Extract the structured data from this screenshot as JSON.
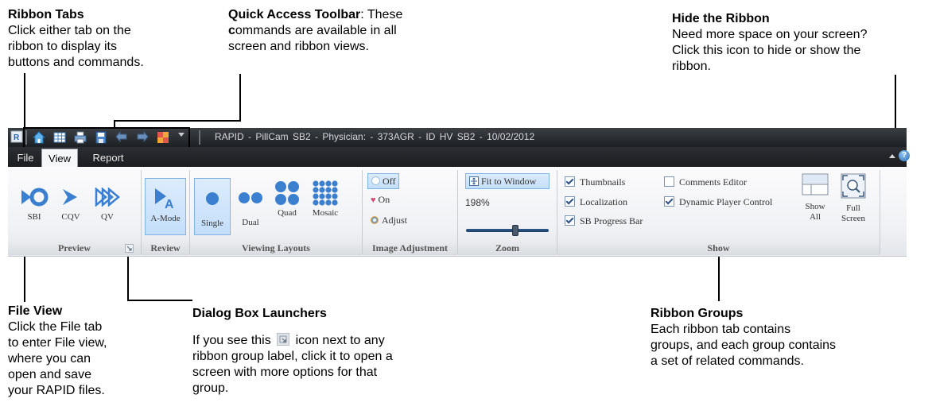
{
  "callouts": {
    "ribbon_tabs": {
      "title": "Ribbon Tabs",
      "lines": [
        "Click either tab on the",
        "ribbon to display its",
        "buttons and commands."
      ]
    },
    "quick_access": {
      "title": "Quick Access Toolbar",
      "title_suffix": ": These",
      "lead_bold": "c",
      "lines_after_lead": "ommands are available in all",
      "lines": [
        "screen and ribbon views."
      ]
    },
    "hide_ribbon": {
      "title": "Hide the Ribbon",
      "lines": [
        "Need more space on your screen?",
        "Click this icon to hide or show the",
        "ribbon."
      ]
    },
    "file_view": {
      "title": "File View",
      "lines": [
        "Click the File tab",
        "to enter File view,",
        "where you can",
        "open and save",
        "your RAPID files."
      ]
    },
    "dialog_launchers": {
      "title": "Dialog Box Launchers",
      "line1_before": "If you see this",
      "line1_after": "icon next to any",
      "lines": [
        "ribbon group label, click it to open a",
        "screen with more options for that",
        "group."
      ]
    },
    "ribbon_groups": {
      "title": "Ribbon Groups",
      "lines": [
        "Each ribbon tab contains",
        "groups, and each group contains",
        "a set of related commands."
      ]
    }
  },
  "window": {
    "title": "RAPID  -  PillCam SB2  -  Physician:  -  373AGR - ID HV SB2  -  10/02/2012",
    "tabs": [
      {
        "label": "File",
        "active": false
      },
      {
        "label": "View",
        "active": true
      },
      {
        "label": "Report",
        "active": false
      }
    ],
    "qat_icons": [
      "home-icon",
      "grid-icon",
      "print-icon",
      "save-icon",
      "back-icon",
      "forward-icon",
      "puzzle-icon"
    ]
  },
  "ribbon": {
    "groups": [
      {
        "label": "Preview"
      },
      {
        "label": "Review"
      },
      {
        "label": "Viewing Layouts"
      },
      {
        "label": "Image Adjustment"
      },
      {
        "label": "Zoom"
      },
      {
        "label": "Show"
      }
    ],
    "preview_buttons": [
      "SBI",
      "CQV",
      "QV"
    ],
    "review_buttons": [
      "A-Mode"
    ],
    "layout_buttons": [
      "Single",
      "Dual",
      "Quad",
      "Mosaic"
    ],
    "adjust_options": [
      "Off",
      "On",
      "Adjust"
    ],
    "zoom": {
      "fit_label": "Fit to Window",
      "level": "198%",
      "slider_fraction": 0.6
    },
    "show_checks": [
      {
        "label": "Thumbnails",
        "checked": true
      },
      {
        "label": "Localization",
        "checked": true
      },
      {
        "label": "SB Progress Bar",
        "checked": true
      },
      {
        "label": "Comments Editor",
        "checked": false
      },
      {
        "label": "Dynamic Player Control",
        "checked": true
      }
    ],
    "show_buttons": [
      {
        "line1": "Show",
        "line2": "All"
      },
      {
        "line1": "Full",
        "line2": "Screen"
      }
    ]
  },
  "colors": {
    "accent_blue": "#3a7fd0",
    "selected_bg": "#c4defa",
    "titlebar": "#1d2023"
  }
}
